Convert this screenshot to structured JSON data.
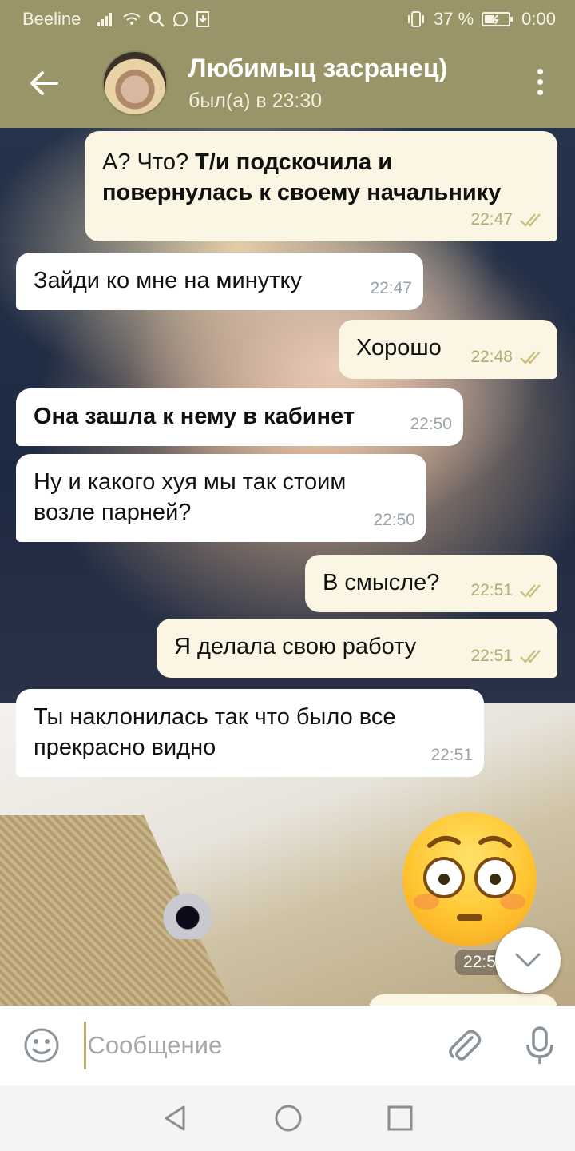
{
  "status_bar": {
    "carrier": "Beeline",
    "battery": "37 %",
    "time": "0:00",
    "icons": [
      "signal-icon",
      "wifi-icon",
      "search-icon",
      "whatsapp-icon",
      "download-icon",
      "vibrate-icon",
      "battery-icon"
    ]
  },
  "header": {
    "title": "Любимыц засранец)",
    "subtitle": "был(а) в 23:30"
  },
  "messages": [
    {
      "dir": "out",
      "text_plain": "А? Что? ",
      "text_bold": "Т/и подскочила и повернулась к своему начальнику",
      "time": "22:47",
      "read": true
    },
    {
      "dir": "in",
      "text": "Зайди ко мне на минутку",
      "time": "22:47"
    },
    {
      "dir": "out",
      "text": "Хорошо",
      "time": "22:48",
      "read": true
    },
    {
      "dir": "in",
      "text": "Она зашла к нему в кабинет",
      "time": "22:50",
      "bold": true
    },
    {
      "dir": "in",
      "text": "Ну и какого хуя мы так стоим возле парней?",
      "time": "22:50"
    },
    {
      "dir": "out",
      "text": "В смысле?",
      "time": "22:51",
      "read": true
    },
    {
      "dir": "out",
      "text": "Я делала свою работу",
      "time": "22:51",
      "read": true
    },
    {
      "dir": "in",
      "text": "Ты наклонилась так что было все прекрасно видно",
      "time": "22:51"
    }
  ],
  "sticker": {
    "emoji": "flushed-face",
    "time": "22:5"
  },
  "composer": {
    "placeholder": "Сообщение"
  },
  "colors": {
    "header": "#9a9568",
    "outgoing_bubble": "#fbf6e3",
    "incoming_bubble": "#ffffff",
    "check": "#b3ab76"
  }
}
